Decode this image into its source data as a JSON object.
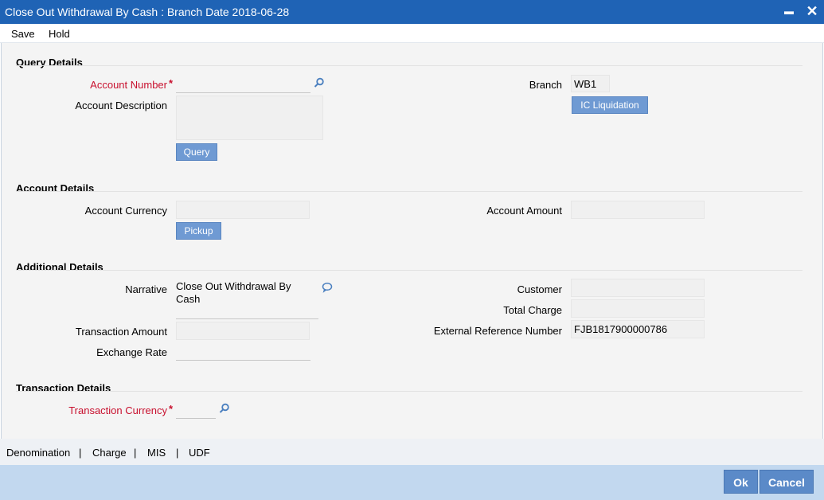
{
  "window": {
    "title": "Close Out Withdrawal By Cash : Branch Date 2018-06-28",
    "minimize": "▬",
    "close": "✕"
  },
  "menu": {
    "save": "Save",
    "hold": "Hold"
  },
  "query": {
    "heading": "Query Details",
    "account_number_label": "Account Number",
    "account_number_value": "",
    "account_description_label": "Account Description",
    "account_description_value": "",
    "query_button": "Query",
    "branch_label": "Branch",
    "branch_value": "WB1",
    "ic_liquidation_button": "IC Liquidation"
  },
  "account": {
    "heading": "Account Details",
    "currency_label": "Account Currency",
    "currency_value": "",
    "pickup_button": "Pickup",
    "amount_label": "Account Amount",
    "amount_value": ""
  },
  "additional": {
    "heading": "Additional Details",
    "narrative_label": "Narrative",
    "narrative_line1": "Close Out Withdrawal By",
    "narrative_line2": "Cash",
    "transaction_amount_label": "Transaction Amount",
    "transaction_amount_value": "",
    "exchange_rate_label": "Exchange Rate",
    "exchange_rate_value": "",
    "customer_label": "Customer",
    "customer_value": "",
    "total_charge_label": "Total Charge",
    "total_charge_value": "",
    "external_ref_label": "External Reference Number",
    "external_ref_value": "FJB1817900000786"
  },
  "transaction": {
    "heading": "Transaction Details",
    "currency_label": "Transaction Currency",
    "currency_value": ""
  },
  "required_marker": "*",
  "tabs": {
    "denomination": "Denomination",
    "charge": "Charge",
    "mis": "MIS",
    "udf": "UDF",
    "separator": "|"
  },
  "footer": {
    "ok": "Ok",
    "cancel": "Cancel"
  },
  "icons": {
    "search": "search-icon",
    "comment": "comment-icon"
  },
  "colors": {
    "titlebar": "#1f63b5",
    "required": "#c8102e",
    "button": "#6f9ad3",
    "footer": "#c2d8ef"
  }
}
